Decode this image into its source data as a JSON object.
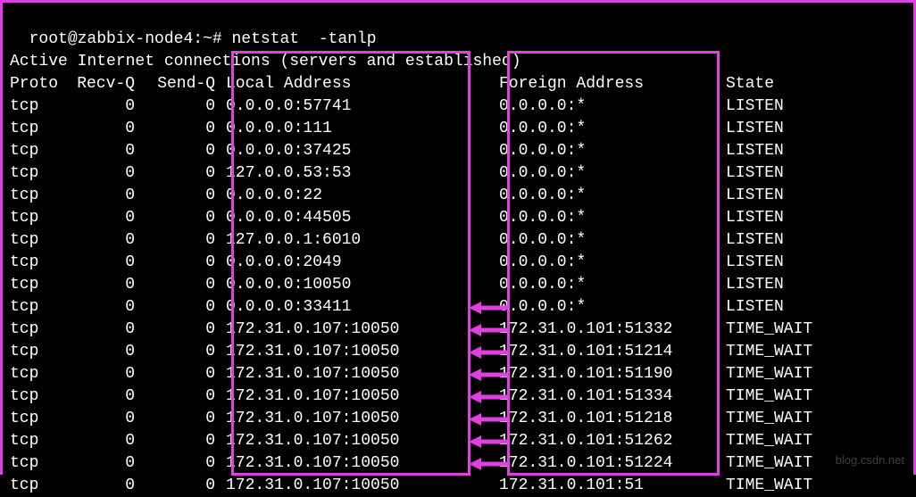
{
  "prompt": {
    "user_host": "root@zabbix-node4",
    "cwd": "~",
    "symbol": "#",
    "command": "netstat  -tanlp"
  },
  "active_line": "Active Internet connections (servers and established)",
  "headers": {
    "proto": "Proto",
    "recvq": "Recv-Q",
    "sendq": "Send-Q",
    "local": "Local Address",
    "foreign": "Foreign Address",
    "state": "State"
  },
  "rows": [
    {
      "proto": "tcp",
      "recvq": "0",
      "sendq": "0",
      "local": "0.0.0.0:57741",
      "foreign": "0.0.0.0:*",
      "state": "LISTEN",
      "arrow": false
    },
    {
      "proto": "tcp",
      "recvq": "0",
      "sendq": "0",
      "local": "0.0.0.0:111",
      "foreign": "0.0.0.0:*",
      "state": "LISTEN",
      "arrow": false
    },
    {
      "proto": "tcp",
      "recvq": "0",
      "sendq": "0",
      "local": "0.0.0.0:37425",
      "foreign": "0.0.0.0:*",
      "state": "LISTEN",
      "arrow": false
    },
    {
      "proto": "tcp",
      "recvq": "0",
      "sendq": "0",
      "local": "127.0.0.53:53",
      "foreign": "0.0.0.0:*",
      "state": "LISTEN",
      "arrow": false
    },
    {
      "proto": "tcp",
      "recvq": "0",
      "sendq": "0",
      "local": "0.0.0.0:22",
      "foreign": "0.0.0.0:*",
      "state": "LISTEN",
      "arrow": false
    },
    {
      "proto": "tcp",
      "recvq": "0",
      "sendq": "0",
      "local": "0.0.0.0:44505",
      "foreign": "0.0.0.0:*",
      "state": "LISTEN",
      "arrow": false
    },
    {
      "proto": "tcp",
      "recvq": "0",
      "sendq": "0",
      "local": "127.0.0.1:6010",
      "foreign": "0.0.0.0:*",
      "state": "LISTEN",
      "arrow": false
    },
    {
      "proto": "tcp",
      "recvq": "0",
      "sendq": "0",
      "local": "0.0.0.0:2049",
      "foreign": "0.0.0.0:*",
      "state": "LISTEN",
      "arrow": false
    },
    {
      "proto": "tcp",
      "recvq": "0",
      "sendq": "0",
      "local": "0.0.0.0:10050",
      "foreign": "0.0.0.0:*",
      "state": "LISTEN",
      "arrow": false
    },
    {
      "proto": "tcp",
      "recvq": "0",
      "sendq": "0",
      "local": "0.0.0.0:33411",
      "foreign": "0.0.0.0:*",
      "state": "LISTEN",
      "arrow": false
    },
    {
      "proto": "tcp",
      "recvq": "0",
      "sendq": "0",
      "local": "172.31.0.107:10050",
      "foreign": "172.31.0.101:51332",
      "state": "TIME_WAIT",
      "arrow": true
    },
    {
      "proto": "tcp",
      "recvq": "0",
      "sendq": "0",
      "local": "172.31.0.107:10050",
      "foreign": "172.31.0.101:51214",
      "state": "TIME_WAIT",
      "arrow": true
    },
    {
      "proto": "tcp",
      "recvq": "0",
      "sendq": "0",
      "local": "172.31.0.107:10050",
      "foreign": "172.31.0.101:51190",
      "state": "TIME_WAIT",
      "arrow": true
    },
    {
      "proto": "tcp",
      "recvq": "0",
      "sendq": "0",
      "local": "172.31.0.107:10050",
      "foreign": "172.31.0.101:51334",
      "state": "TIME_WAIT",
      "arrow": true
    },
    {
      "proto": "tcp",
      "recvq": "0",
      "sendq": "0",
      "local": "172.31.0.107:10050",
      "foreign": "172.31.0.101:51218",
      "state": "TIME_WAIT",
      "arrow": true
    },
    {
      "proto": "tcp",
      "recvq": "0",
      "sendq": "0",
      "local": "172.31.0.107:10050",
      "foreign": "172.31.0.101:51262",
      "state": "TIME_WAIT",
      "arrow": true
    },
    {
      "proto": "tcp",
      "recvq": "0",
      "sendq": "0",
      "local": "172.31.0.107:10050",
      "foreign": "172.31.0.101:51224",
      "state": "TIME_WAIT",
      "arrow": true
    },
    {
      "proto": "tcp",
      "recvq": "0",
      "sendq": "0",
      "local": "172.31.0.107:10050",
      "foreign": "172.31.0.101:51",
      "state": "TIME_WAIT",
      "arrow": true
    }
  ],
  "watermark": "blog.csdn.net"
}
